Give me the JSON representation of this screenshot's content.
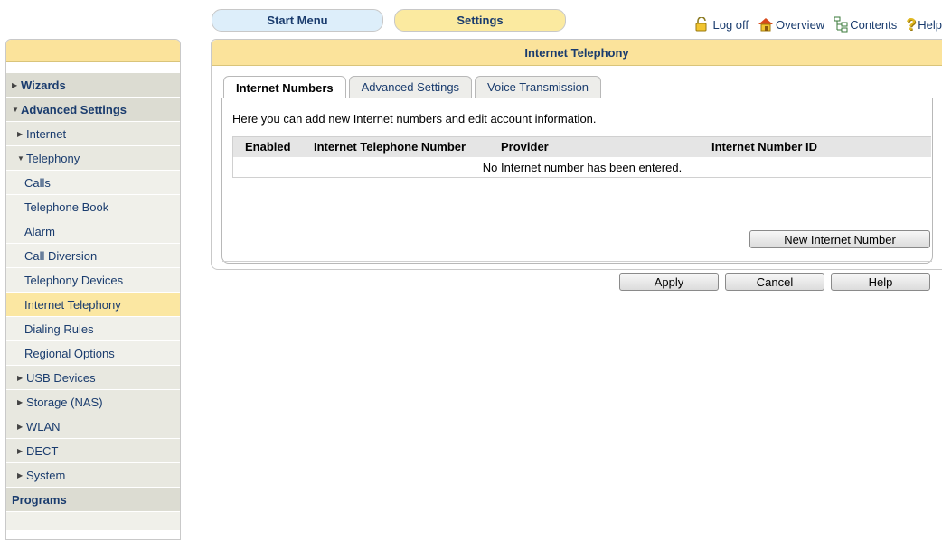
{
  "top_tabs": {
    "start_menu": "Start Menu",
    "settings": "Settings"
  },
  "top_links": {
    "logoff": "Log off",
    "overview": "Overview",
    "contents": "Contents",
    "help": "Help"
  },
  "sidebar": {
    "items": [
      {
        "label": "Wizards",
        "level": 0,
        "tri": "right"
      },
      {
        "label": "Advanced Settings",
        "level": 0,
        "tri": "down"
      },
      {
        "label": "Internet",
        "level": 1,
        "tri": "right"
      },
      {
        "label": "Telephony",
        "level": 1,
        "tri": "down"
      },
      {
        "label": "Calls",
        "level": 2
      },
      {
        "label": "Telephone Book",
        "level": 2
      },
      {
        "label": "Alarm",
        "level": 2
      },
      {
        "label": "Call Diversion",
        "level": 2
      },
      {
        "label": "Telephony Devices",
        "level": 2
      },
      {
        "label": "Internet Telephony",
        "level": 2,
        "active": true
      },
      {
        "label": "Dialing Rules",
        "level": 2
      },
      {
        "label": "Regional Options",
        "level": 2
      },
      {
        "label": "USB Devices",
        "level": 1,
        "tri": "right"
      },
      {
        "label": "Storage (NAS)",
        "level": 1,
        "tri": "right"
      },
      {
        "label": "WLAN",
        "level": 1,
        "tri": "right"
      },
      {
        "label": "DECT",
        "level": 1,
        "tri": "right"
      },
      {
        "label": "System",
        "level": 1,
        "tri": "right"
      },
      {
        "label": "Programs",
        "level": 0
      }
    ]
  },
  "panel": {
    "title": "Internet Telephony",
    "tabs": [
      "Internet Numbers",
      "Advanced Settings",
      "Voice Transmission"
    ],
    "active_tab": 0,
    "intro": "Here you can add new Internet numbers and edit account information.",
    "table": {
      "columns": [
        "Enabled",
        "Internet Telephone Number",
        "Provider",
        "Internet Number ID"
      ],
      "empty_message": "No Internet number has been entered."
    },
    "buttons": {
      "new_number": "New Internet Number",
      "apply": "Apply",
      "cancel": "Cancel",
      "help": "Help"
    }
  },
  "colors": {
    "accent_yellow": "#fbe39b",
    "start_blue": "#ddeefa",
    "link_blue": "#1a3c6e"
  }
}
